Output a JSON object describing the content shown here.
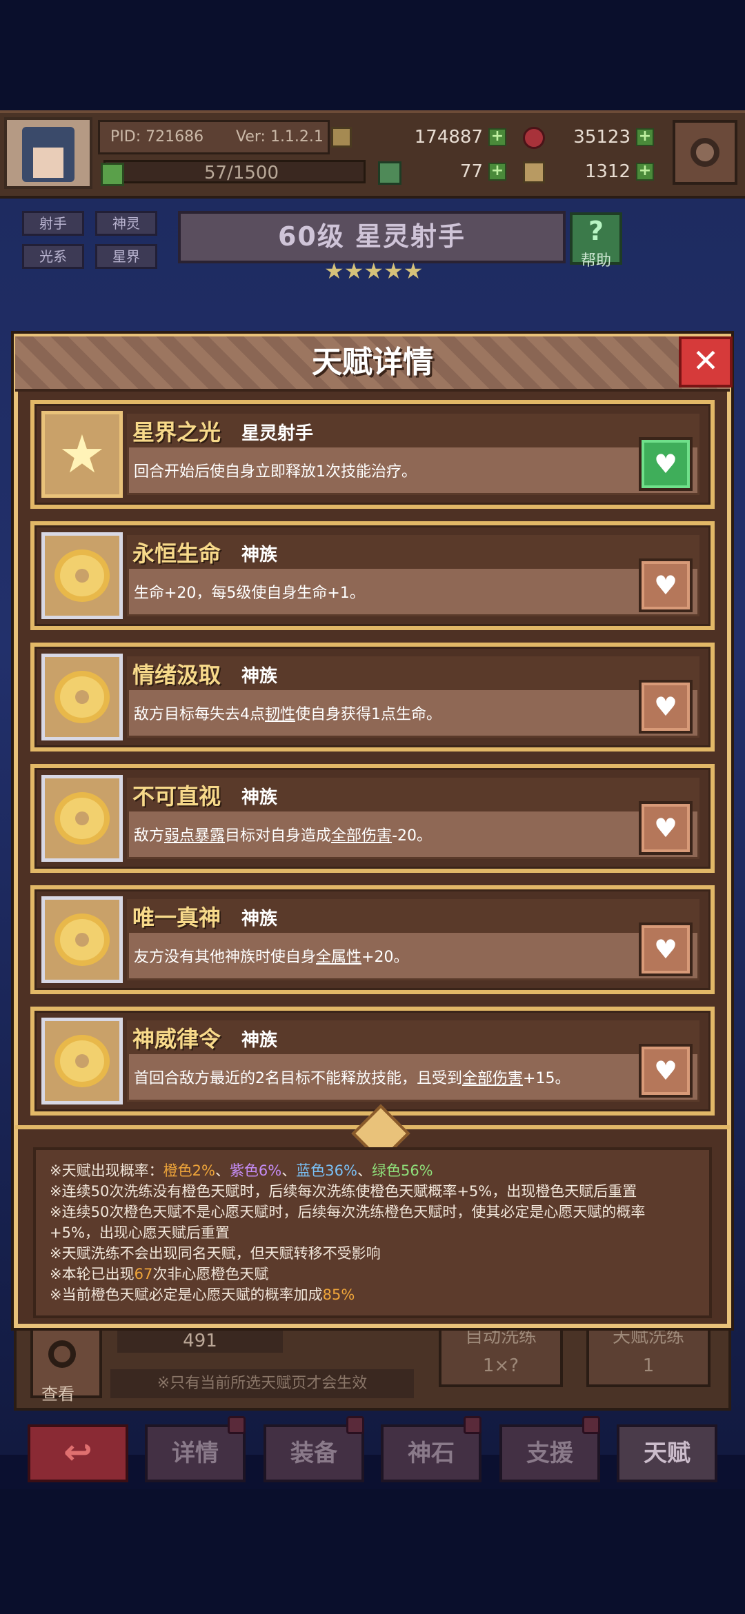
{
  "header": {
    "pid": "PID: 721686",
    "version": "Ver: 1.1.2.1",
    "gold": "174887",
    "gems": "35123",
    "xp": "57/1500",
    "clover": "77",
    "boots": "1312"
  },
  "hero": {
    "tags": [
      "射手",
      "神灵",
      "光系",
      "星界"
    ],
    "level_title": "60级  星灵射手",
    "help_label": "帮助",
    "stars": 5
  },
  "modal": {
    "title": "天赋详情",
    "close_label": "✕",
    "talents": [
      {
        "name": "星界之光",
        "type": "星灵射手",
        "desc_pre": "回合开始后使自身立即释放1次技能治疗。",
        "desc_u": "",
        "desc_post": "",
        "active": true
      },
      {
        "name": "永恒生命",
        "type": "神族",
        "desc_pre": "生命+20，每5级使自身生命+1。",
        "desc_u": "",
        "desc_post": "",
        "active": false
      },
      {
        "name": "情绪汲取",
        "type": "神族",
        "desc_pre": "敌方目标每失去4点",
        "desc_u": "韧性",
        "desc_post": "使自身获得1点生命。",
        "active": false
      },
      {
        "name": "不可直视",
        "type": "神族",
        "desc_pre": "敌方",
        "desc_u": "弱点暴露",
        "desc_post": "目标对自身造成",
        "desc_u2": "全部伤害",
        "desc_post2": "-20。",
        "active": false
      },
      {
        "name": "唯一真神",
        "type": "神族",
        "desc_pre": "友方没有其他神族时使自身",
        "desc_u": "全属性",
        "desc_post": "+20。",
        "active": false
      },
      {
        "name": "神威律令",
        "type": "神族",
        "desc_pre": "首回合敌方最近的2名目标不能释放技能，且受到",
        "desc_u": "全部伤害",
        "desc_post": "+15。",
        "active": false
      }
    ],
    "info": {
      "l1_pre": "※天赋出现概率：",
      "orange": "橙色2%",
      "sep1": "、",
      "purple": "紫色6%",
      "sep2": "、",
      "blue": "蓝色36%",
      "sep3": "、",
      "green": "绿色56%",
      "l2": "※连续50次洗练没有橙色天赋时，后续每次洗练使橙色天赋概率+5%，出现橙色天赋后重置",
      "l3a": "※连续50次橙色天赋不是心愿天赋时，后续每次洗练橙色天赋时，使其必定是心愿天赋的概率",
      "l3b": "+5%，出现心愿天赋后重置",
      "l4": "※天赋洗练不会出现同名天赋，但天赋转移不受影响",
      "l5_pre": "※本轮已出现",
      "l5_num": "67",
      "l5_post": "次非心愿橙色天赋",
      "l6_pre": "※当前橙色天赋必定是心愿天赋的概率加成",
      "l6_num": "85%"
    }
  },
  "bottom": {
    "count": "491",
    "search_label": "查看",
    "note": "※只有当前所选天赋页才会生效",
    "auto_reroll": "自动洗练",
    "auto_cost": "1×?",
    "talent_reroll": "天赋洗练",
    "talent_cost": "1"
  },
  "nav": {
    "back": "↩",
    "items": [
      "详情",
      "装备",
      "神石",
      "支援",
      "天赋"
    ]
  }
}
